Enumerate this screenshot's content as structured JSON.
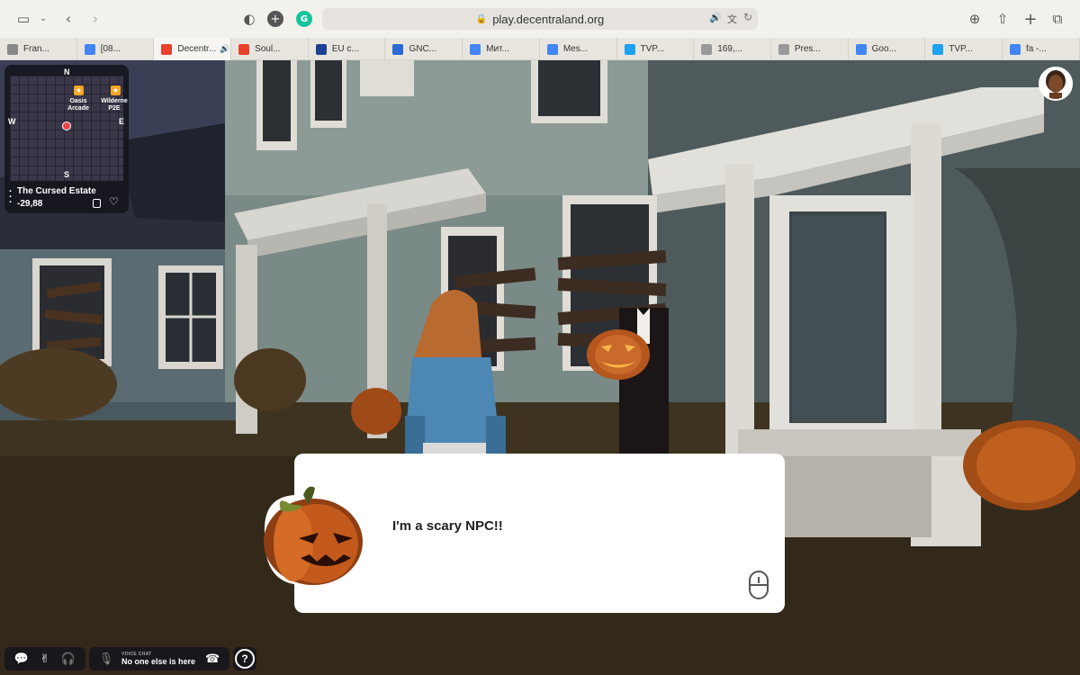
{
  "browser": {
    "url": "play.decentraland.org",
    "tabs": [
      {
        "label": "Fran...",
        "favicon_color": "#888888",
        "active": false
      },
      {
        "label": "[08...",
        "favicon_color": "#4285f4",
        "active": false
      },
      {
        "label": "Decentr...",
        "favicon_color": "#e8412c",
        "active": true,
        "audio": true
      },
      {
        "label": "Soul...",
        "favicon_color": "#e8412c",
        "active": false
      },
      {
        "label": "EU c...",
        "favicon_color": "#1d3f94",
        "active": false
      },
      {
        "label": "GNC...",
        "favicon_color": "#2a6ad3",
        "active": false
      },
      {
        "label": "Мит...",
        "favicon_color": "#4285f4",
        "active": false
      },
      {
        "label": "Mes...",
        "favicon_color": "#4285f4",
        "active": false
      },
      {
        "label": "TVP...",
        "favicon_color": "#1da1f2",
        "active": false
      },
      {
        "label": "169,...",
        "favicon_color": "#999999",
        "active": false
      },
      {
        "label": "Pres...",
        "favicon_color": "#999999",
        "active": false
      },
      {
        "label": "Goo...",
        "favicon_color": "#4285f4",
        "active": false
      },
      {
        "label": "TVP...",
        "favicon_color": "#1da1f2",
        "active": false
      },
      {
        "label": "fa -...",
        "favicon_color": "#4285f4",
        "active": false
      }
    ]
  },
  "minimap": {
    "directions": {
      "n": "N",
      "s": "S",
      "e": "E",
      "w": "W"
    },
    "pois": [
      {
        "name": "Oasis\nArcade",
        "line1": "Oasis",
        "line2": "Arcade"
      },
      {
        "name": "Wilderness P2E",
        "line1": "Wilderne",
        "line2": "P2E"
      }
    ],
    "scene_name": "The Cursed Estate",
    "coords": "-29,88"
  },
  "dialog": {
    "text": "I'm a scary NPC!!"
  },
  "bottombar": {
    "voice_chat_label": "VOICE CHAT",
    "voice_chat_status": "No one else is here",
    "help": "?"
  },
  "colors": {
    "ui_dark": "#14141c",
    "poi_orange": "#f5a623",
    "player_marker": "#e64545"
  }
}
